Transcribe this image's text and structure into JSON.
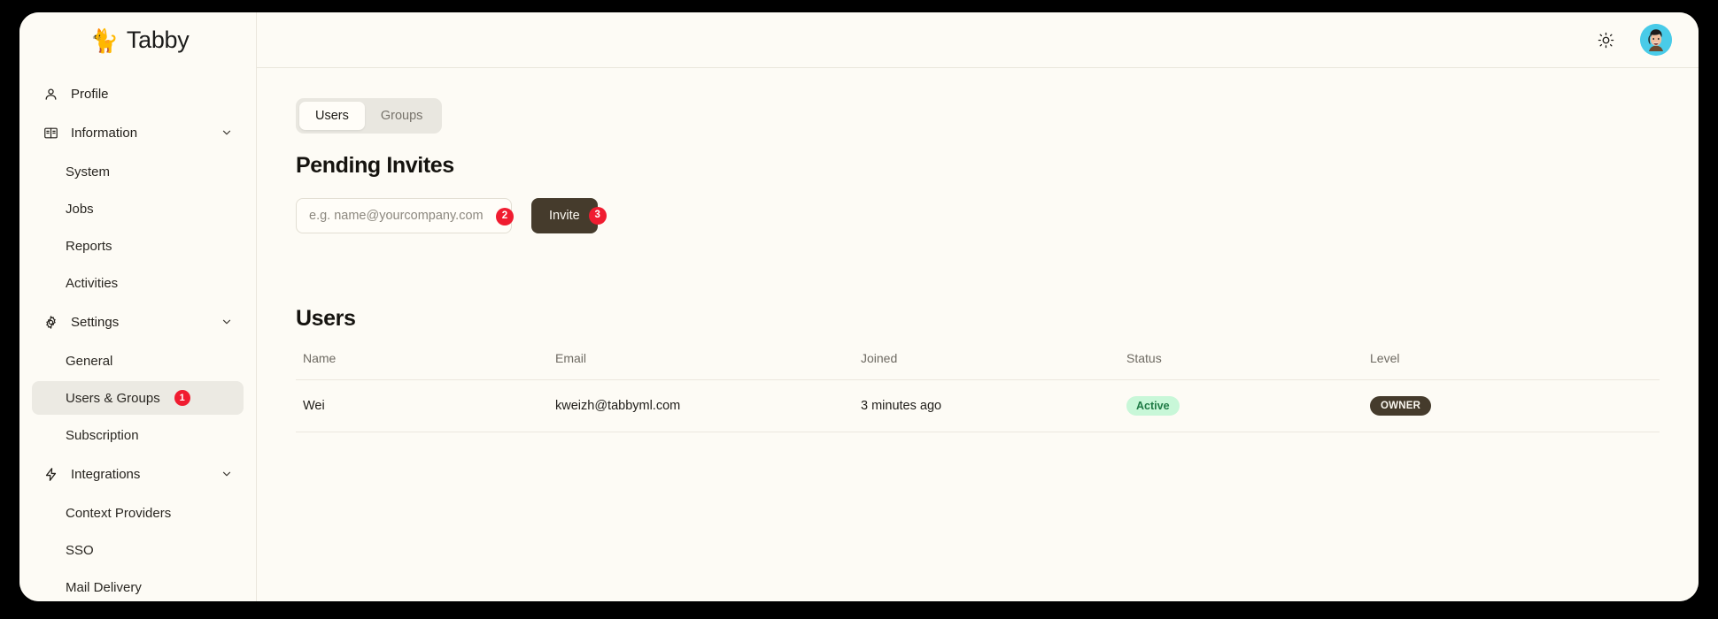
{
  "brand": {
    "logo_icon": "tabby-cat-logo-icon",
    "name": "Tabby"
  },
  "sidebar": {
    "items": [
      {
        "label": "Profile",
        "icon": "user-icon",
        "type": "leaf-with-icon"
      },
      {
        "label": "Information",
        "icon": "book-icon",
        "type": "group",
        "expanded": true
      },
      {
        "label": "System",
        "type": "leaf"
      },
      {
        "label": "Jobs",
        "type": "leaf"
      },
      {
        "label": "Reports",
        "type": "leaf"
      },
      {
        "label": "Activities",
        "type": "leaf"
      },
      {
        "label": "Settings",
        "icon": "gear-icon",
        "type": "group",
        "expanded": true
      },
      {
        "label": "General",
        "type": "leaf"
      },
      {
        "label": "Users & Groups",
        "type": "leaf",
        "active": true,
        "marker": "1"
      },
      {
        "label": "Subscription",
        "type": "leaf"
      },
      {
        "label": "Integrations",
        "icon": "bolt-icon",
        "type": "group",
        "expanded": true
      },
      {
        "label": "Context Providers",
        "type": "leaf"
      },
      {
        "label": "SSO",
        "type": "leaf"
      },
      {
        "label": "Mail Delivery",
        "type": "leaf"
      }
    ]
  },
  "topbar": {
    "theme_toggle_icon": "sun-icon",
    "avatar_icon": "user-avatar"
  },
  "tabs": [
    {
      "label": "Users",
      "active": true
    },
    {
      "label": "Groups",
      "active": false
    }
  ],
  "pending_invites": {
    "title": "Pending Invites",
    "email_input": {
      "value": "",
      "placeholder": "e.g. name@yourcompany.com",
      "marker": "2"
    },
    "invite_button": {
      "label": "Invite",
      "marker": "3"
    }
  },
  "users_section": {
    "title": "Users",
    "columns": [
      "Name",
      "Email",
      "Joined",
      "Status",
      "Level"
    ],
    "rows": [
      {
        "name": "Wei",
        "email": "kweizh@tabbyml.com",
        "joined": "3 minutes ago",
        "status": "Active",
        "level": "OWNER"
      }
    ]
  },
  "colors": {
    "page_background": "#000000",
    "surface": "#fdfbf5",
    "accent_dark": "#453b2c",
    "marker_red": "#f01c30",
    "status_active_bg": "#c8f7d8",
    "status_active_text": "#1f7a45",
    "avatar_bg": "#49cbe8"
  }
}
